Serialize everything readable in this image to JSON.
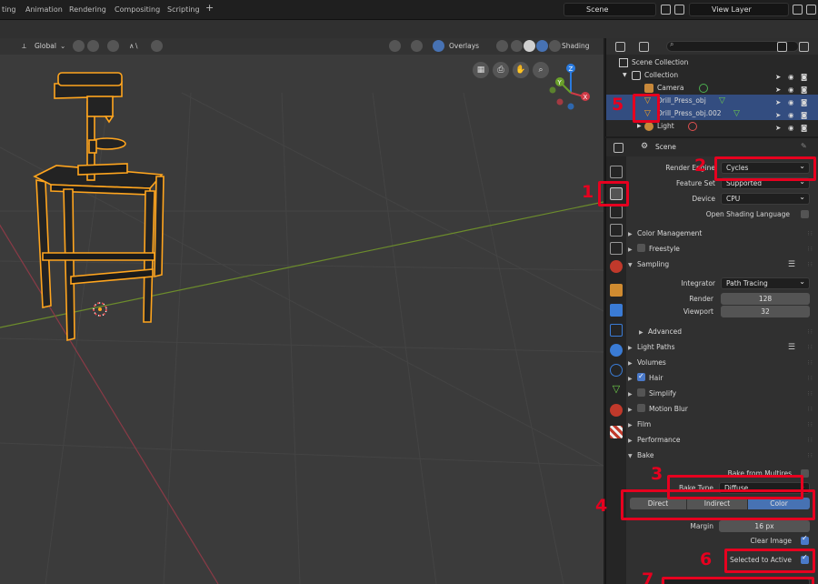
{
  "topbar": {
    "tabs": [
      "ting",
      "Animation",
      "Rendering",
      "Compositing",
      "Scripting"
    ],
    "add_tab": "+",
    "scene_field": "Scene",
    "view_layer_field": "View Layer"
  },
  "viewport": {
    "transform_orientation": "Global",
    "overlays_label": "Overlays",
    "shading_label": "Shading"
  },
  "outliner": {
    "root": "Scene Collection",
    "rows": [
      {
        "label": "Collection"
      },
      {
        "label": "Camera"
      },
      {
        "label": "Drill_Press_obj"
      },
      {
        "label": "Drill_Press_obj.002"
      },
      {
        "label": "Light"
      }
    ]
  },
  "properties": {
    "context": "Scene",
    "render_engine_label": "Render Engine",
    "render_engine_value": "Cycles",
    "feature_set_label": "Feature Set",
    "feature_set_value": "Supported",
    "device_label": "Device",
    "device_value": "CPU",
    "osl_label": "Open Shading Language",
    "sections_top": [
      "Color Management",
      "Freestyle",
      "Sampling"
    ],
    "integrator_label": "Integrator",
    "integrator_value": "Path Tracing",
    "render_label": "Render",
    "render_value": "128",
    "viewport_label": "Viewport",
    "viewport_value": "32",
    "advanced_label": "Advanced",
    "sections_mid": [
      "Light Paths",
      "Volumes",
      "Hair",
      "Simplify",
      "Motion Blur",
      "Film",
      "Performance",
      "Bake"
    ],
    "bake_from_multires": "Bake from Multires",
    "bake_type_label": "Bake Type",
    "bake_type_value": "Diffuse",
    "contrib": [
      "Direct",
      "Indirect",
      "Color"
    ],
    "margin_label": "Margin",
    "margin_value": "16 px",
    "clear_image_label": "Clear Image",
    "selected_to_active_label": "Selected to Active"
  },
  "annotations": {
    "labels": [
      "1",
      "2",
      "3",
      "4",
      "5",
      "6",
      "7"
    ],
    "color": "#e6001f"
  },
  "colors": {
    "selection_orange": "#ffa51e",
    "active_blue": "#4772b3",
    "grid_x_axis": "#8a3a46",
    "grid_y_axis": "#6c8c2c"
  }
}
